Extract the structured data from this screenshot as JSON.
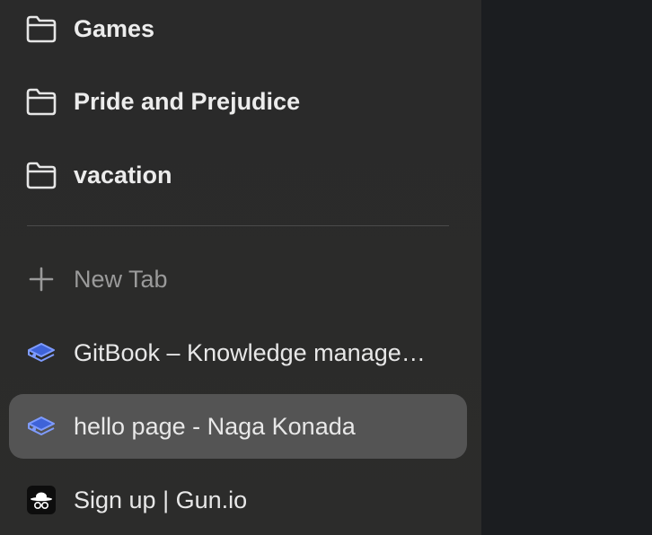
{
  "folders": [
    {
      "label": "Games",
      "icon": "folder-icon"
    },
    {
      "label": "Pride and Prejudice",
      "icon": "folder-icon"
    },
    {
      "label": "vacation",
      "icon": "folder-icon"
    }
  ],
  "new_tab": {
    "label": "New Tab",
    "icon": "plus-icon"
  },
  "tabs": [
    {
      "label": "GitBook – Knowledge management for technical teams",
      "icon": "gitbook-icon",
      "selected": false
    },
    {
      "label": "hello page - Naga Konada",
      "icon": "gitbook-icon",
      "selected": true
    },
    {
      "label": "Sign up | Gun.io",
      "icon": "gunio-icon",
      "selected": false
    }
  ],
  "colors": {
    "sidebar_bg": "#2b2b2a",
    "selected_bg": "#545454",
    "content_bg": "#1b1d20",
    "gitbook_accent": "#6b8cff"
  }
}
